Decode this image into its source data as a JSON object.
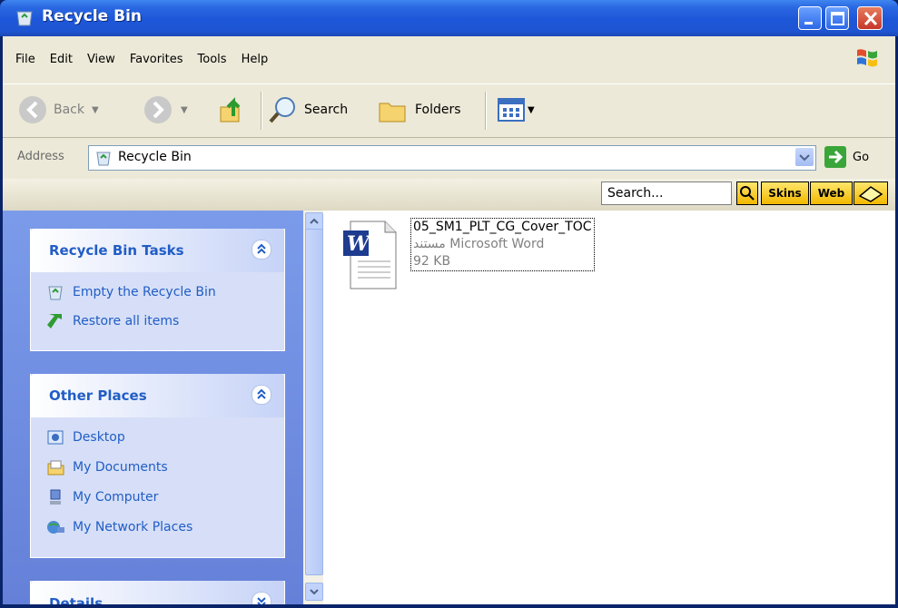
{
  "window": {
    "title": "Recycle Bin"
  },
  "menu": [
    "File",
    "Edit",
    "View",
    "Favorites",
    "Tools",
    "Help"
  ],
  "toolbar": {
    "back_label": "Back",
    "search_label": "Search",
    "folders_label": "Folders"
  },
  "address": {
    "label": "Address",
    "value": "Recycle Bin",
    "go_label": "Go"
  },
  "skinbar": {
    "search_placeholder": "Search...",
    "skins_label": "Skins",
    "web_label": "Web"
  },
  "tasks": {
    "title": "Recycle Bin Tasks",
    "items": [
      "Empty the Recycle Bin",
      "Restore all items"
    ]
  },
  "places": {
    "title": "Other Places",
    "items": [
      "Desktop",
      "My Documents",
      "My Computer",
      "My Network Places"
    ]
  },
  "details": {
    "title": "Details"
  },
  "file": {
    "name": "05_SM1_PLT_CG_Cover_TOC",
    "type": "مستند Microsoft Word",
    "size": "92 KB"
  }
}
